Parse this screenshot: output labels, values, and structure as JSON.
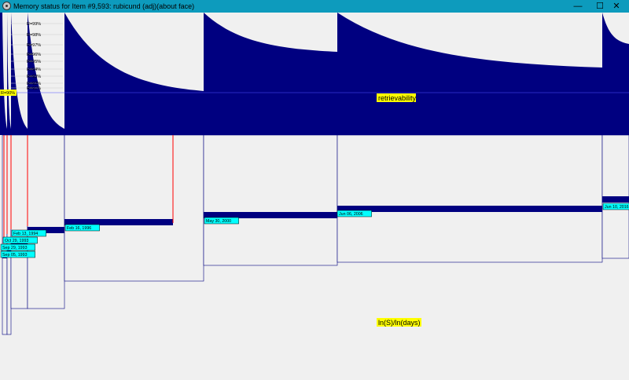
{
  "window": {
    "title": "Memory status for Item #9,593: rubicund (adj)(about face)",
    "minimize_glyph": "—",
    "maximize_glyph": "☐",
    "close_glyph": "✕",
    "icon": "app-icon"
  },
  "chart_data": [
    {
      "type": "area",
      "panel": "retrievability",
      "series_label": "retrievability",
      "threshold_label": "R=90%",
      "r_levels": [
        "R=99%",
        "R=98%",
        "R=97%",
        "R=96%",
        "R=95%",
        "R=94%",
        "R=93%",
        "R=92%",
        "R=91%"
      ],
      "r_values": [
        0.99,
        0.98,
        0.97,
        0.96,
        0.95,
        0.94,
        0.93,
        0.92,
        0.91
      ],
      "threshold": 0.9,
      "curve_min": [
        0.8,
        0.8,
        0.8,
        0.88,
        0.9,
        0.9,
        0.88
      ],
      "y_range": [
        0.8,
        1.0
      ]
    },
    {
      "type": "bar",
      "panel": "stability",
      "series_label": "ln(S)/ln(days)",
      "review_dates": [
        "Sep 05, 1993",
        "Sep 29, 1993",
        "Oct 29, 1993",
        "Feb 13, 1994",
        "Feb 16, 1996",
        "May 30, 2000",
        "Jun 06, 2006",
        "Jun 10, 2016"
      ],
      "ratio": [
        0.16,
        0.17,
        0.23,
        0.29,
        0.4,
        0.48,
        0.54,
        0.77
      ],
      "stability_level": [
        0.88,
        0.85,
        0.82,
        0.78,
        0.68,
        0.58,
        0.55,
        0.45
      ]
    }
  ],
  "colors": {
    "navy": "#000080",
    "blue": "#0000ff",
    "panel_bg": "#f0f0f0",
    "label_bg": "#ffff00",
    "date_bg": "#00ffff",
    "red": "#ff0000",
    "grid": "#cccccc"
  }
}
